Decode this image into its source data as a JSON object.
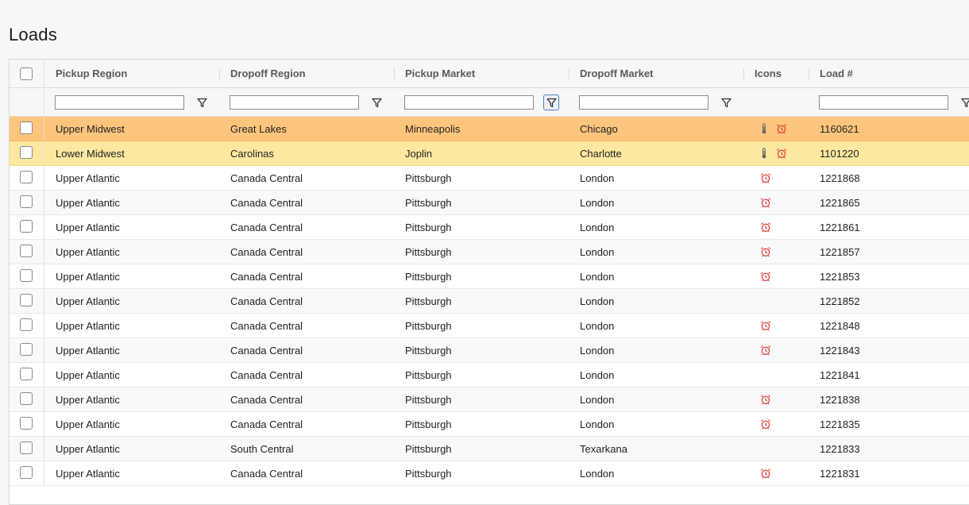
{
  "page": {
    "title": "Loads"
  },
  "columns": [
    {
      "key": "pickup_region",
      "label": "Pickup Region"
    },
    {
      "key": "dropoff_region",
      "label": "Dropoff Region"
    },
    {
      "key": "pickup_market",
      "label": "Pickup Market"
    },
    {
      "key": "dropoff_market",
      "label": "Dropoff Market"
    },
    {
      "key": "icons",
      "label": "Icons"
    },
    {
      "key": "load_number",
      "label": "Load #"
    }
  ],
  "filters": {
    "pickup_region": "",
    "dropoff_region": "",
    "pickup_market": "",
    "dropoff_market": "",
    "load_number": "",
    "active_filter": "pickup_market"
  },
  "colors": {
    "highlight_orange": "#fdc57c",
    "highlight_yellow": "#fde8a0",
    "alarm_icon": "#e0332f"
  },
  "rows": [
    {
      "pickup_region": "Upper Midwest",
      "dropoff_region": "Great Lakes",
      "pickup_market": "Minneapolis",
      "dropoff_market": "Chicago",
      "icons": [
        "thermometer-icon",
        "alarm-clock-icon"
      ],
      "load_number": "1160621",
      "highlight": "orange"
    },
    {
      "pickup_region": "Lower Midwest",
      "dropoff_region": "Carolinas",
      "pickup_market": "Joplin",
      "dropoff_market": "Charlotte",
      "icons": [
        "thermometer-icon",
        "alarm-clock-icon"
      ],
      "load_number": "1101220",
      "highlight": "yellow"
    },
    {
      "pickup_region": "Upper Atlantic",
      "dropoff_region": "Canada Central",
      "pickup_market": "Pittsburgh",
      "dropoff_market": "London",
      "icons": [
        "alarm-clock-icon"
      ],
      "load_number": "1221868",
      "highlight": "none"
    },
    {
      "pickup_region": "Upper Atlantic",
      "dropoff_region": "Canada Central",
      "pickup_market": "Pittsburgh",
      "dropoff_market": "London",
      "icons": [
        "alarm-clock-icon"
      ],
      "load_number": "1221865",
      "highlight": "none"
    },
    {
      "pickup_region": "Upper Atlantic",
      "dropoff_region": "Canada Central",
      "pickup_market": "Pittsburgh",
      "dropoff_market": "London",
      "icons": [
        "alarm-clock-icon"
      ],
      "load_number": "1221861",
      "highlight": "none"
    },
    {
      "pickup_region": "Upper Atlantic",
      "dropoff_region": "Canada Central",
      "pickup_market": "Pittsburgh",
      "dropoff_market": "London",
      "icons": [
        "alarm-clock-icon"
      ],
      "load_number": "1221857",
      "highlight": "none"
    },
    {
      "pickup_region": "Upper Atlantic",
      "dropoff_region": "Canada Central",
      "pickup_market": "Pittsburgh",
      "dropoff_market": "London",
      "icons": [
        "alarm-clock-icon"
      ],
      "load_number": "1221853",
      "highlight": "none"
    },
    {
      "pickup_region": "Upper Atlantic",
      "dropoff_region": "Canada Central",
      "pickup_market": "Pittsburgh",
      "dropoff_market": "London",
      "icons": [],
      "load_number": "1221852",
      "highlight": "none"
    },
    {
      "pickup_region": "Upper Atlantic",
      "dropoff_region": "Canada Central",
      "pickup_market": "Pittsburgh",
      "dropoff_market": "London",
      "icons": [
        "alarm-clock-icon"
      ],
      "load_number": "1221848",
      "highlight": "none"
    },
    {
      "pickup_region": "Upper Atlantic",
      "dropoff_region": "Canada Central",
      "pickup_market": "Pittsburgh",
      "dropoff_market": "London",
      "icons": [
        "alarm-clock-icon"
      ],
      "load_number": "1221843",
      "highlight": "none"
    },
    {
      "pickup_region": "Upper Atlantic",
      "dropoff_region": "Canada Central",
      "pickup_market": "Pittsburgh",
      "dropoff_market": "London",
      "icons": [],
      "load_number": "1221841",
      "highlight": "none"
    },
    {
      "pickup_region": "Upper Atlantic",
      "dropoff_region": "Canada Central",
      "pickup_market": "Pittsburgh",
      "dropoff_market": "London",
      "icons": [
        "alarm-clock-icon"
      ],
      "load_number": "1221838",
      "highlight": "none"
    },
    {
      "pickup_region": "Upper Atlantic",
      "dropoff_region": "Canada Central",
      "pickup_market": "Pittsburgh",
      "dropoff_market": "London",
      "icons": [
        "alarm-clock-icon"
      ],
      "load_number": "1221835",
      "highlight": "none"
    },
    {
      "pickup_region": "Upper Atlantic",
      "dropoff_region": "South Central",
      "pickup_market": "Pittsburgh",
      "dropoff_market": "Texarkana",
      "icons": [],
      "load_number": "1221833",
      "highlight": "none"
    },
    {
      "pickup_region": "Upper Atlantic",
      "dropoff_region": "Canada Central",
      "pickup_market": "Pittsburgh",
      "dropoff_market": "London",
      "icons": [
        "alarm-clock-icon"
      ],
      "load_number": "1221831",
      "highlight": "none"
    }
  ]
}
